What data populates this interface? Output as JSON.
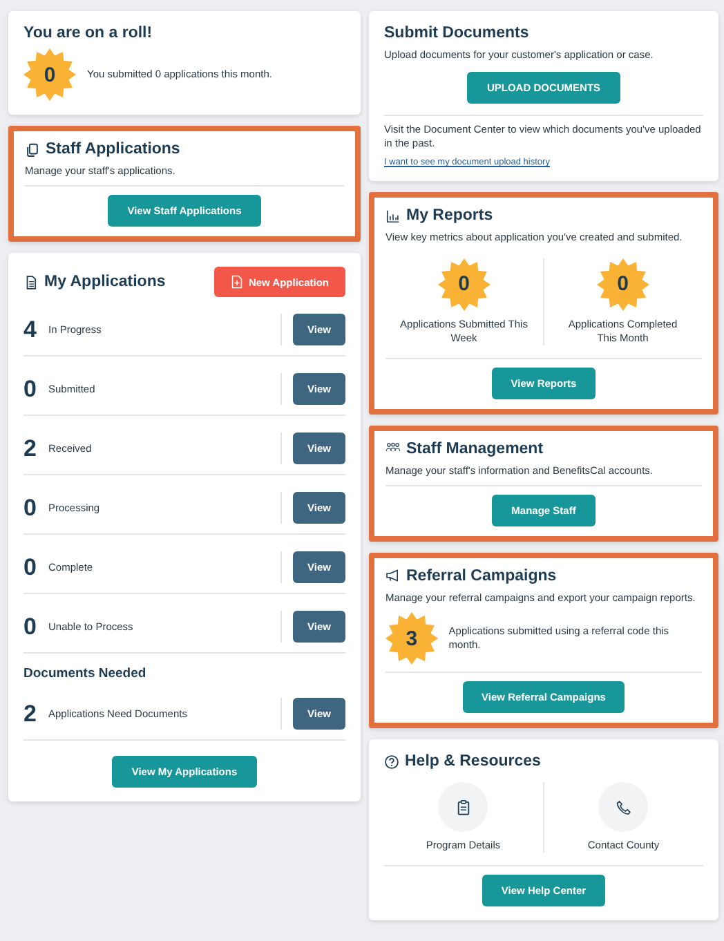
{
  "roll_card": {
    "title": "You are on a roll!",
    "count": "0",
    "text": "You submitted 0 applications this month.",
    "highlighted": false
  },
  "staff_applications": {
    "title": "Staff Applications",
    "description": "Manage your staff's applications.",
    "button": "View Staff Applications",
    "highlighted": true
  },
  "my_applications": {
    "title": "My Applications",
    "new_button": "New Application",
    "highlighted": false,
    "rows": [
      {
        "count": "4",
        "label": "In Progress",
        "button": "View"
      },
      {
        "count": "0",
        "label": "Submitted",
        "button": "View"
      },
      {
        "count": "2",
        "label": "Received",
        "button": "View"
      },
      {
        "count": "0",
        "label": "Processing",
        "button": "View"
      },
      {
        "count": "0",
        "label": "Complete",
        "button": "View"
      },
      {
        "count": "0",
        "label": "Unable to Process",
        "button": "View"
      }
    ],
    "documents_heading": "Documents Needed",
    "documents_rows": [
      {
        "count": "2",
        "label": "Applications Need Documents",
        "button": "View"
      }
    ],
    "button": "View My Applications"
  },
  "submit_documents": {
    "title": "Submit Documents",
    "description": "Upload documents for your customer's application or case.",
    "button": "UPLOAD DOCUMENTS",
    "note": "Visit the Document Center to view which documents you've uploaded in the past.",
    "link": "I want to see my document upload history",
    "highlighted": false
  },
  "my_reports": {
    "title": "My Reports",
    "description": "View key metrics about application you've created and submited.",
    "highlighted": true,
    "metrics": [
      {
        "count": "0",
        "label": "Applications Submitted This Week"
      },
      {
        "count": "0",
        "label": "Applications Completed This Month"
      }
    ],
    "button": "View Reports"
  },
  "staff_management": {
    "title": "Staff Management",
    "description": "Manage your staff's information and BenefitsCal accounts.",
    "button": "Manage Staff",
    "highlighted": true
  },
  "referral_campaigns": {
    "title": "Referral Campaigns",
    "description": "Manage your referral campaigns and export your campaign reports.",
    "count": "3",
    "text": "Applications submitted using a referral code this month.",
    "button": "View Referral Campaigns",
    "highlighted": true
  },
  "help_resources": {
    "title": "Help & Resources",
    "highlighted": false,
    "items": [
      {
        "kind": "clipboard",
        "label": "Program Details"
      },
      {
        "kind": "phone",
        "label": "Contact County"
      }
    ],
    "button": "View Help Center"
  }
}
